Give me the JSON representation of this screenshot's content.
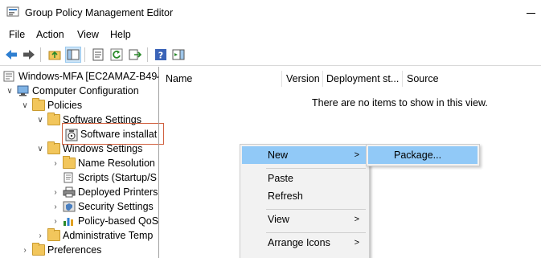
{
  "window": {
    "title": "Group Policy Management Editor"
  },
  "menubar": [
    "File",
    "Action",
    "View",
    "Help"
  ],
  "tree": {
    "root": "Windows-MFA [EC2AMAZ-B494",
    "computer_config": "Computer Configuration",
    "policies": "Policies",
    "software_settings": "Software Settings",
    "software_installation": "Software installat",
    "windows_settings": "Windows Settings",
    "name_resolution": "Name Resolution",
    "scripts": "Scripts (Startup/S",
    "deployed_printers": "Deployed Printers",
    "security_settings": "Security Settings",
    "policy_qos": "Policy-based QoS",
    "admin_templates": "Administrative Temp",
    "preferences": "Preferences"
  },
  "list": {
    "columns": [
      "Name",
      "Version",
      "Deployment st...",
      "Source"
    ],
    "empty_message": "There are no items to show in this view."
  },
  "context_menu": {
    "new": "New",
    "paste": "Paste",
    "refresh": "Refresh",
    "view": "View",
    "arrange_icons": "Arrange Icons",
    "submenu_arrow": ">"
  },
  "submenu": {
    "package": "Package..."
  }
}
